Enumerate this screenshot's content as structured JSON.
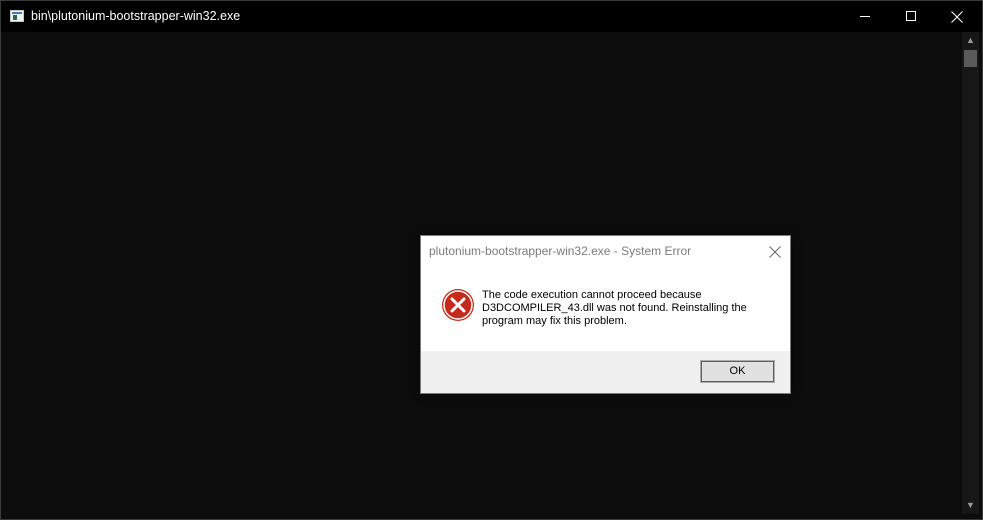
{
  "window": {
    "title": "bin\\plutonium-bootstrapper-win32.exe",
    "icon": "console-app-icon",
    "controls": {
      "minimize": "minimize-icon",
      "maximize": "maximize-icon",
      "close": "close-icon"
    }
  },
  "scrollbar": {
    "up_arrow": "▲",
    "down_arrow": "▼"
  },
  "dialog": {
    "title": "plutonium-bootstrapper-win32.exe - System Error",
    "icon": "error-icon",
    "message": "The code execution cannot proceed because D3DCOMPILER_43.dll was not found. Reinstalling the program may fix this problem.",
    "ok_label": "OK",
    "close_icon": "close-icon"
  },
  "colors": {
    "console_bg": "#0c0c0c",
    "titlebar_bg": "#000000",
    "error_red": "#c42b1c",
    "accent": "#0078d7"
  }
}
